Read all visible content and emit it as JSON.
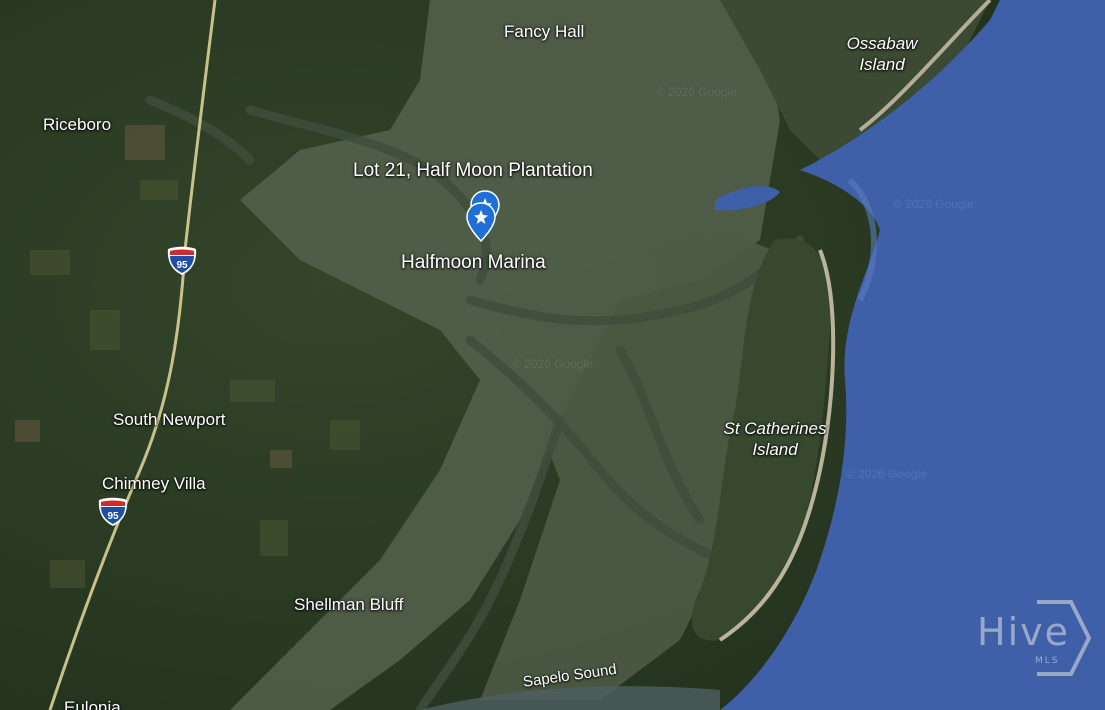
{
  "map": {
    "labels": {
      "fancy_hall": "Fancy Hall",
      "ossabaw_line1": "Ossabaw",
      "ossabaw_line2": "Island",
      "riceboro": "Riceboro",
      "lot21": "Lot 21, Half Moon Plantation",
      "halfmoon_marina": "Halfmoon Marina",
      "south_newport": "South Newport",
      "chimney_villa": "Chimney Villa",
      "st_catherines_line1": "St Catherines",
      "st_catherines_line2": "Island",
      "shellman_bluff": "Shellman Bluff",
      "sapelo_sound": "Sapelo Sound",
      "bottom_partial": "Eulonia"
    },
    "highway_shield": "95",
    "watermark": "© 2026 Google",
    "branding": {
      "name": "Hive",
      "sub": "MLS"
    },
    "colors": {
      "ocean": "#3f60a8",
      "marker": "#1f6fd6",
      "land": "#2c3d24",
      "marsh": "#5b6a55"
    }
  }
}
